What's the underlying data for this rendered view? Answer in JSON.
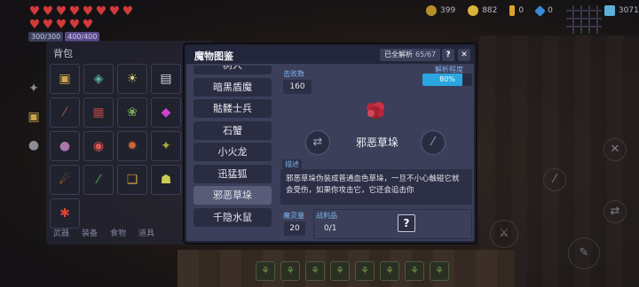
{
  "hud": {
    "hearts": [
      "♥",
      "♥",
      "♥",
      "♥",
      "♥",
      "♥",
      "♥",
      "♥",
      "♥",
      "♥",
      "♥",
      "♥",
      "♥"
    ],
    "hp": "300/300",
    "mp": "400/400",
    "resources": [
      {
        "icon": "gold-badge-icon",
        "value": "399"
      },
      {
        "icon": "coin-icon",
        "value": "882"
      },
      {
        "icon": "key-icon",
        "value": "0"
      },
      {
        "icon": "gem-icon",
        "value": "0"
      },
      {
        "icon": "crystal-icon",
        "value": "3071"
      }
    ]
  },
  "bag": {
    "title": "背包",
    "tabs": [
      "武器",
      "装备",
      "食物",
      "道具"
    ],
    "slots": [
      "▣",
      "◈",
      "☀",
      "▤",
      "",
      "⁄",
      "▦",
      "❀",
      "◆",
      "",
      "●",
      "◉",
      "✹",
      "✦",
      "",
      "☄",
      "⁄",
      "❏",
      "☗",
      "",
      "✱"
    ]
  },
  "modal": {
    "title": "魔物图鉴",
    "progress_label": "已全解析",
    "progress_count": "65/67",
    "help_label": "?",
    "close_label": "✕",
    "list": [
      "树人",
      "暗黑盾魔",
      "骷髅士兵",
      "石蟹",
      "小火龙",
      "迅猛狐",
      "邪恶草垛",
      "千隐水鼠"
    ],
    "selected_index": 6,
    "detail": {
      "kills_label": "击败数",
      "kills_value": "160",
      "analysis_label": "解析程度",
      "analysis_text": "80%",
      "analysis_fraction": 0.8,
      "name": "邪恶草垛",
      "desc_label": "描述",
      "description_line1": "邪恶草垛伪装成普通血色草垛，一旦不小心触碰它就",
      "description_line2": "会受伤，如果你攻击它，它还会追击你",
      "soul_label": "魔灵量",
      "soul_value": "20",
      "loot_label": "战利品",
      "loot_value": "0/1",
      "loot_unknown": "?",
      "prev_icon": "swap-arrows-icon",
      "next_icon": "sword-icon"
    }
  },
  "colors": {
    "accent_blue": "#2aa6e0",
    "label_blue": "#7db4f0",
    "panel": "#3b3f5a",
    "header": "#23263a"
  }
}
